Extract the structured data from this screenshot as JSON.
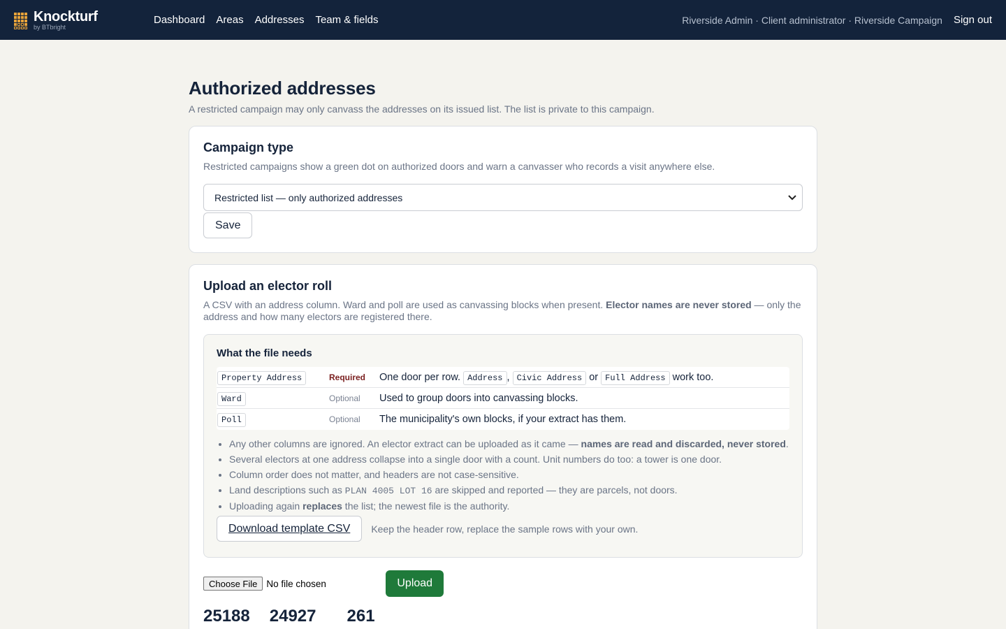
{
  "app": {
    "name": "Knockturf",
    "sub": "by BTbright"
  },
  "nav": [
    {
      "label": "Dashboard"
    },
    {
      "label": "Areas"
    },
    {
      "label": "Addresses"
    },
    {
      "label": "Team & fields"
    }
  ],
  "user": {
    "info": "Riverside Admin · Client administrator · Riverside Campaign",
    "signout": "Sign out"
  },
  "page": {
    "title": "Authorized addresses",
    "lead": "A restricted campaign may only canvass the addresses on its issued list. The list is private to this campaign."
  },
  "campaign_type": {
    "title": "Campaign type",
    "desc": "Restricted campaigns show a green dot on authorized doors and warn a canvasser who records a visit anywhere else.",
    "selected": "Restricted list — only authorized addresses",
    "save_label": "Save"
  },
  "upload": {
    "title": "Upload an elector roll",
    "desc_part1": "A CSV with an address column. Ward and poll are used as canvassing blocks when present. ",
    "desc_bold": "Elector names are never stored",
    "desc_part2": " — only the address and how many electors are registered there.",
    "needs_title": "What the file needs",
    "columns": [
      {
        "name": "Property Address",
        "status": "Required",
        "desc_pre": "One door per row. ",
        "alts": [
          "Address",
          "Civic Address",
          "Full Address"
        ],
        "alt_sep1": ", ",
        "alt_sep2": " or ",
        "desc_post": " work too."
      },
      {
        "name": "Ward",
        "status": "Optional",
        "desc": "Used to group doors into canvassing blocks."
      },
      {
        "name": "Poll",
        "status": "Optional",
        "desc": "The municipality's own blocks, if your extract has them."
      }
    ],
    "notes": {
      "n1_pre": "Any other columns are ignored. An elector extract can be uploaded as it came — ",
      "n1_bold": "names are read and discarded, never stored",
      "n1_post": ".",
      "n2": "Several electors at one address collapse into a single door with a count. Unit numbers do too: a tower is one door.",
      "n3": "Column order does not matter, and headers are not case-sensitive.",
      "n4_pre": "Land descriptions such as ",
      "n4_code": "PLAN 4005 LOT 16",
      "n4_post": " are skipped and reported — they are parcels, not doors.",
      "n5_pre": "Uploading again ",
      "n5_bold": "replaces",
      "n5_post": " the list; the newest file is the authority."
    },
    "template_label": "Download template CSV",
    "template_note": "Keep the header row, replace the sample rows with your own.",
    "file_button": "Choose File",
    "file_status": "No file chosen",
    "upload_label": "Upload",
    "stats": [
      "25188",
      "24927",
      "261"
    ]
  },
  "colors": {
    "topbar": "#13233b",
    "accent": "#e6a23a",
    "upload_green": "#1f7a3a",
    "required": "#7a1f1f"
  }
}
